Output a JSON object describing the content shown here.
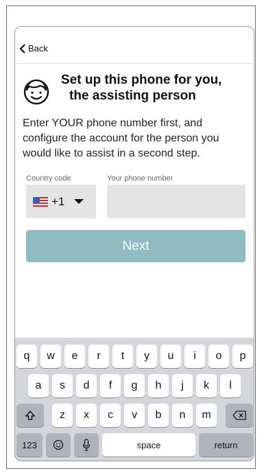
{
  "nav": {
    "back_label": "Back"
  },
  "header": {
    "title_line1": "Set up this phone for you,",
    "title_line2": "the assisting person",
    "description": "Enter YOUR phone number first, and configure the account for the person you would like to assist in a second step."
  },
  "form": {
    "country_code_label": "Country code",
    "country_code_value": "+1",
    "country_flag": "us-flag",
    "phone_label": "Your phone number",
    "phone_value": "",
    "phone_placeholder": ""
  },
  "next_button": {
    "label": "Next",
    "color": "#8fbcc2"
  },
  "keyboard": {
    "row1": [
      "q",
      "w",
      "e",
      "r",
      "t",
      "y",
      "u",
      "i",
      "o",
      "p"
    ],
    "row2": [
      "a",
      "s",
      "d",
      "f",
      "g",
      "h",
      "j",
      "k",
      "l"
    ],
    "row3": [
      "z",
      "x",
      "c",
      "v",
      "b",
      "n",
      "m"
    ],
    "shift_icon": "shift-icon",
    "delete_icon": "delete-icon",
    "numbers_label": "123",
    "emoji_icon": "emoji-icon",
    "mic_icon": "microphone-icon",
    "space_label": "space",
    "return_label": "return"
  }
}
